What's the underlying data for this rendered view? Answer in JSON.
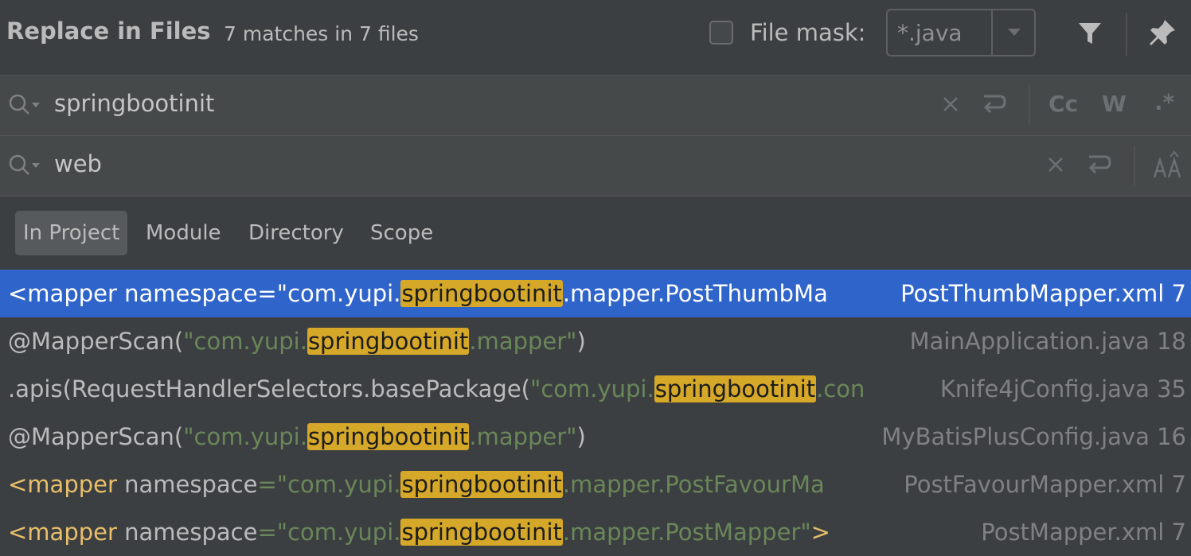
{
  "header": {
    "title": "Replace in Files",
    "subtitle": "7 matches in 7 files",
    "file_mask_label": "File mask:",
    "file_mask_value": "*.java"
  },
  "search": {
    "find_value": "springbootinit",
    "replace_value": "web",
    "option_case": "Cc",
    "option_words": "W",
    "option_regex": ".*"
  },
  "scopes": [
    {
      "label": "In Project",
      "active": true
    },
    {
      "label": "Module",
      "active": false
    },
    {
      "label": "Directory",
      "active": false
    },
    {
      "label": "Scope",
      "active": false
    }
  ],
  "results": [
    {
      "pre_plain": "<mapper namespace=\"com.yupi.",
      "match": "springbootinit",
      "post": ".mapper.PostThumbMa",
      "file": "PostThumbMapper.xml 7",
      "selected": true
    },
    {
      "pre_plain": "@MapperScan(",
      "pre_str": "\"com.yupi.",
      "match": "springbootinit",
      "post_str": ".mapper\"",
      "post_plain": ")",
      "file": "MainApplication.java 18"
    },
    {
      "pre_plain": ".apis(RequestHandlerSelectors.basePackage(",
      "pre_str": "\"com.yupi.",
      "match": "springbootinit",
      "post_str": ".con",
      "file": "Knife4jConfig.java 35"
    },
    {
      "pre_plain": "@MapperScan(",
      "pre_str": "\"com.yupi.",
      "match": "springbootinit",
      "post_str": ".mapper\"",
      "post_plain": ")",
      "file": "MyBatisPlusConfig.java 16"
    },
    {
      "pre_tag": "<mapper",
      "pre_plain": " namespace",
      "pre_str": "=\"com.yupi.",
      "match": "springbootinit",
      "post_str": ".mapper.PostFavourMa",
      "file": "PostFavourMapper.xml 7"
    },
    {
      "pre_tag": "<mapper",
      "pre_plain": " namespace",
      "pre_str": "=\"com.yupi.",
      "match": "springbootinit",
      "post_str": ".mapper.PostMapper\"",
      "post_tag": ">",
      "file": "PostMapper.xml 7"
    }
  ],
  "colors": {
    "background": "#3c3f41",
    "selection": "#2f65ca",
    "match_highlight": "#d6a829",
    "string": "#6a8759",
    "tag": "#e8bf6a"
  }
}
